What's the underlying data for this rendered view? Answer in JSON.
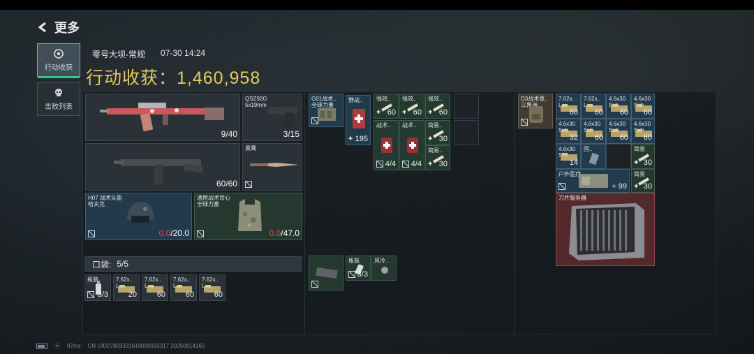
{
  "header": {
    "back_label": "更多"
  },
  "sidebar": [
    {
      "label": "行动收获",
      "icon": "loot-icon",
      "active": true
    },
    {
      "label": "击败列表",
      "icon": "skull-icon",
      "active": false
    }
  ],
  "meta": {
    "map": "零号大坝-常规",
    "time": "07-30 14:24"
  },
  "total": {
    "label": "行动收获：",
    "value": "1,460,958"
  },
  "weapons": {
    "primary_ammo": "9/40",
    "pistol_name": "QSZ92G\n5x19mm",
    "pistol_ammo": "3/15",
    "secondary_ammo": "60/60",
    "melee_name": "黑鹰"
  },
  "armor": {
    "helmet_name": "H07 战术头盔\n哈夫克",
    "helmet_dur": "0.0",
    "helmet_max": "/20.0",
    "vest_name": "通用战术背心\n全球力量",
    "vest_dur": "0.0",
    "vest_max": "/47.0"
  },
  "pocket": {
    "label": "口袋:",
    "count": "5/5",
    "items": [
      {
        "name": "瓶装",
        "count": "3/3"
      },
      {
        "name": "7.62x..\nL",
        "count": "20"
      },
      {
        "name": "7.62x..\nL",
        "count": "60"
      },
      {
        "name": "7.62x..\nL",
        "count": "60"
      },
      {
        "name": "7.62x..\nL",
        "count": "60"
      }
    ]
  },
  "rig": {
    "chest_name": "G01战术..\n全球力量",
    "items": [
      {
        "name": "野战..",
        "count": "195"
      },
      {
        "name": "强效..",
        "count": "60"
      },
      {
        "name": "强效..",
        "count": "60"
      },
      {
        "name": "强效..",
        "count": "60"
      },
      {
        "name": "战术..",
        "count": "4/4"
      },
      {
        "name": "战术..",
        "count": "4/4"
      },
      {
        "name": "简易..",
        "count": "30"
      },
      {
        "name": "简易..",
        "count": "30"
      }
    ]
  },
  "rig_pocket": [
    {
      "name": "",
      "count": ""
    },
    {
      "name": "瓶装",
      "count": "3/3"
    },
    {
      "name": "风冷..",
      "count": ""
    }
  ],
  "backpack": {
    "bag_name": "D3战术登..\n三角洲",
    "items": [
      {
        "name": "7.62x..\nL",
        "count": "60"
      },
      {
        "name": "7.62x..\nL",
        "count": "60"
      },
      {
        "name": "4.6x30\nSub",
        "count": "60"
      },
      {
        "name": "4.6x30\nSub",
        "count": "60"
      },
      {
        "name": "4.6x30\nSub",
        "count": "32"
      },
      {
        "name": "4.6x30\nSub",
        "count": "60"
      },
      {
        "name": "4.6x30\nSub",
        "count": "60"
      },
      {
        "name": "4.6x30\nSub",
        "count": "60"
      },
      {
        "name": "4.6x30\nSub",
        "count": "14"
      },
      {
        "name": "固..",
        "count": ""
      },
      {
        "name": "简易",
        "count": "30"
      },
      {
        "name": "户外医疗",
        "count": "99"
      },
      {
        "name": "简易",
        "count": "30"
      }
    ],
    "server_name": "刀片服务器"
  },
  "status": {
    "ping": "97ms",
    "uid": "CN UID27803331619000933317 20250814165"
  },
  "colors": {
    "gold": "#e7c860",
    "damage_red": "#e24a4a",
    "accent_green": "#29c98f",
    "legendary_red": "#5c2a2e"
  }
}
